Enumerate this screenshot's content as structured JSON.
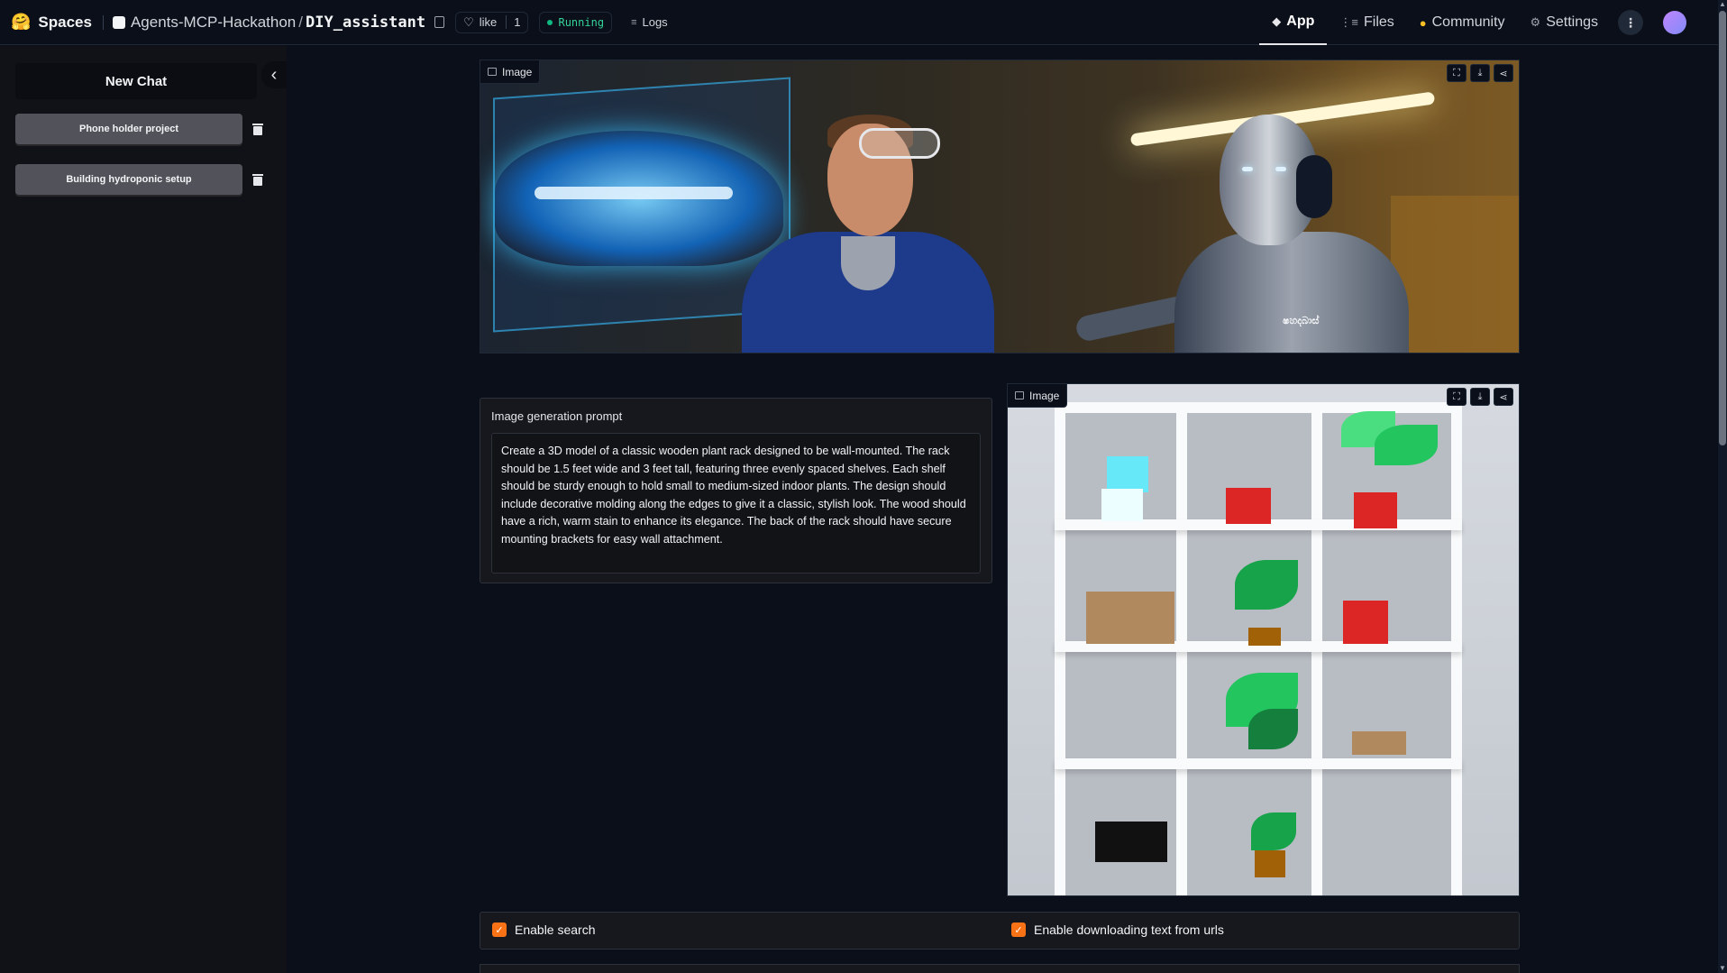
{
  "topbar": {
    "brand": "Spaces",
    "repo_owner": "Agents-MCP-Hackathon",
    "repo_separator": "/",
    "repo_name": "DIY_assistant",
    "like_label": "like",
    "like_count": "1",
    "status": "Running",
    "logs_label": "Logs",
    "nav": [
      {
        "label": "App",
        "icon": "app-icon",
        "active": true
      },
      {
        "label": "Files",
        "icon": "files-icon",
        "active": false
      },
      {
        "label": "Community",
        "icon": "community-icon",
        "active": false
      },
      {
        "label": "Settings",
        "icon": "gear-icon",
        "active": false
      }
    ]
  },
  "sidebar": {
    "new_chat": "New Chat",
    "chats": [
      {
        "label": "Phone holder project"
      },
      {
        "label": "Building hydroponic setup"
      }
    ]
  },
  "hero_image": {
    "label": "Image",
    "robot_caption": "ෂහදබාස්"
  },
  "prompt": {
    "label": "Image generation prompt",
    "text": "Create a 3D model of a classic wooden plant rack designed to be wall-mounted. The rack should be 1.5 feet wide and 3 feet tall, featuring three evenly spaced shelves. Each shelf should be sturdy enough to hold small to medium-sized indoor plants. The design should include decorative molding along the edges to give it a classic, stylish look. The wood should have a rich, warm stain to enhance its elegance. The back of the rack should have secure mounting brackets for easy wall attachment."
  },
  "shelf_image": {
    "label": "Image"
  },
  "options": {
    "enable_search": "Enable search",
    "enable_download": "Enable downloading text from urls",
    "enable_search_checked": true,
    "enable_download_checked": true
  },
  "colors": {
    "background": "#0b0f19",
    "accent_checkbox": "#f97316",
    "status_green": "#10b981"
  }
}
